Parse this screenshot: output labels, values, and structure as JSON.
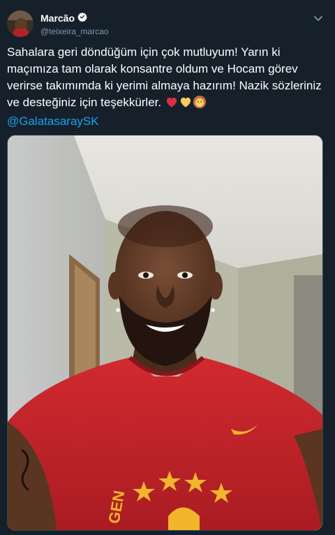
{
  "tweet": {
    "display_name": "Marcão",
    "handle": "@teixeira_marcao",
    "text": "Sahalara geri döndüğüm için çok mutluyum! Yarın ki maçımıza tam olarak konsantre oldum ve Hocam görev verirse takımımda ki yerimi almaya hazırım! Nazik sözleriniz ve desteğiniz için teşekkürler.",
    "mention": "@GalatasaraySK",
    "emojis": [
      "red-heart-icon",
      "yellow-heart-icon",
      "lion-face-icon"
    ],
    "photo_jersey_text": "GEN"
  },
  "colors": {
    "background": "#15202b",
    "text": "#ffffff",
    "secondary_text": "#8899a6",
    "link": "#1da1f2",
    "verified": "#ffffff",
    "jersey_red": "#c8252c",
    "star_gold": "#f2b52b"
  }
}
